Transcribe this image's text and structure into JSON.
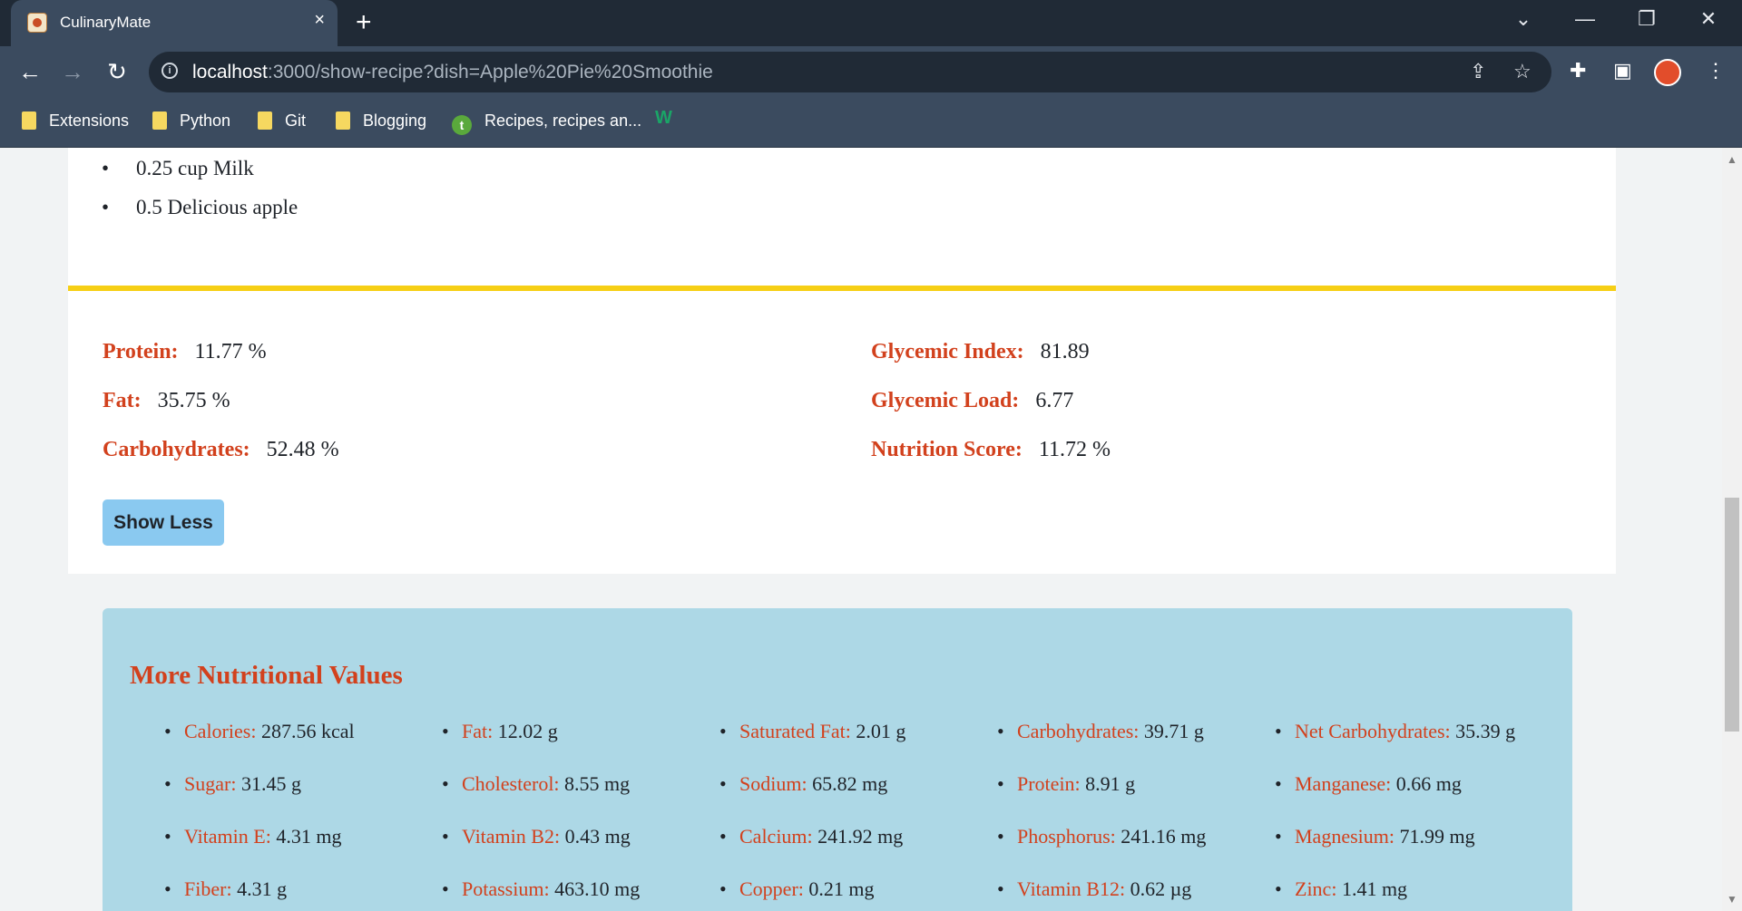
{
  "browser": {
    "tab_title": "CulinaryMate",
    "tab_close": "×",
    "new_tab": "+",
    "window_controls": {
      "chevron": "⌄",
      "minimize": "—",
      "restore": "❐",
      "close": "✕"
    },
    "url_host": "localhost",
    "url_rest": ":3000/show-recipe?dish=Apple%20Pie%20Smoothie",
    "bookmarks": [
      "Extensions",
      "Python",
      "Git",
      "Blogging",
      "Recipes, recipes an..."
    ],
    "icons": [
      "back-icon",
      "forward-icon",
      "reload-icon",
      "info-icon",
      "share-icon",
      "star-icon",
      "extensions-icon",
      "sidebar-icon",
      "profile-avatar",
      "menu-icon"
    ]
  },
  "recipe": {
    "ingredients": [
      "0.25 cup Milk",
      "0.5 Delicious apple"
    ],
    "macros_left": [
      {
        "label": "Protein:",
        "value": "11.77 %"
      },
      {
        "label": "Fat:",
        "value": "35.75 %"
      },
      {
        "label": "Carbohydrates:",
        "value": "52.48 %"
      }
    ],
    "macros_right": [
      {
        "label": "Glycemic Index:",
        "value": "81.89"
      },
      {
        "label": "Glycemic Load:",
        "value": "6.77"
      },
      {
        "label": "Nutrition Score:",
        "value": "11.72 %"
      }
    ],
    "show_less_label": "Show Less",
    "accent_color": "#d2411d",
    "divider_color": "#f6cf15"
  },
  "more_nutrition": {
    "title": "More Nutritional Values",
    "items": [
      {
        "label": "Calories:",
        "value": "287.56 kcal"
      },
      {
        "label": "Fat:",
        "value": "12.02 g"
      },
      {
        "label": "Saturated Fat:",
        "value": "2.01 g"
      },
      {
        "label": "Carbohydrates:",
        "value": "39.71 g"
      },
      {
        "label": "Net Carbohydrates:",
        "value": "35.39 g"
      },
      {
        "label": "Sugar:",
        "value": "31.45 g"
      },
      {
        "label": "Cholesterol:",
        "value": "8.55 mg"
      },
      {
        "label": "Sodium:",
        "value": "65.82 mg"
      },
      {
        "label": "Protein:",
        "value": "8.91 g"
      },
      {
        "label": "Manganese:",
        "value": "0.66 mg"
      },
      {
        "label": "Vitamin E:",
        "value": "4.31 mg"
      },
      {
        "label": "Vitamin B2:",
        "value": "0.43 mg"
      },
      {
        "label": "Calcium:",
        "value": "241.92 mg"
      },
      {
        "label": "Phosphorus:",
        "value": "241.16 mg"
      },
      {
        "label": "Magnesium:",
        "value": "71.99 mg"
      },
      {
        "label": "Fiber:",
        "value": "4.31 g"
      },
      {
        "label": "Potassium:",
        "value": "463.10 mg"
      },
      {
        "label": "Copper:",
        "value": "0.21 mg"
      },
      {
        "label": "Vitamin B12:",
        "value": "0.62 µg"
      },
      {
        "label": "Zinc:",
        "value": "1.41 mg"
      }
    ],
    "panel_color": "#add8e6"
  }
}
